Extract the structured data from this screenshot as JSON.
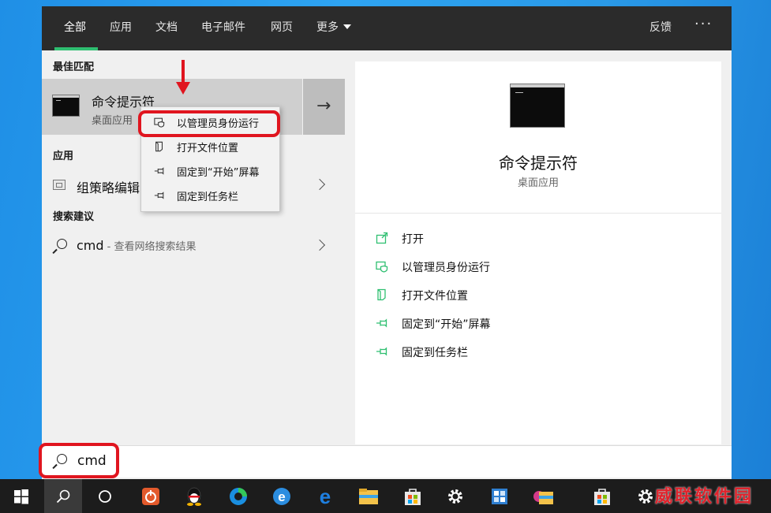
{
  "tabs": [
    {
      "label": "全部",
      "active": true
    },
    {
      "label": "应用"
    },
    {
      "label": "文档"
    },
    {
      "label": "电子邮件"
    },
    {
      "label": "网页"
    },
    {
      "label": "更多"
    }
  ],
  "header": {
    "feedback": "反馈",
    "more_options": "···"
  },
  "left": {
    "best_match_label": "最佳匹配",
    "best_match": {
      "title": "命令提示符",
      "subtitle": "桌面应用",
      "open_arrow": "→"
    },
    "apps_label": "应用",
    "app_item": "组策略编辑",
    "suggestions_label": "搜索建议",
    "web_query": "cmd",
    "web_hint": " - 查看网络搜索结果"
  },
  "context_menu": [
    {
      "label": "以管理员身份运行",
      "icon": "shield-icon"
    },
    {
      "label": "打开文件位置",
      "icon": "folder-icon"
    },
    {
      "label": "固定到“开始”屏幕",
      "icon": "pin-icon"
    },
    {
      "label": "固定到任务栏",
      "icon": "pin-icon"
    }
  ],
  "detail": {
    "title": "命令提示符",
    "subtitle": "桌面应用",
    "actions": [
      {
        "label": "打开",
        "icon": "open-icon"
      },
      {
        "label": "以管理员身份运行",
        "icon": "shield-icon"
      },
      {
        "label": "打开文件位置",
        "icon": "folder-icon"
      },
      {
        "label": "固定到“开始”屏幕",
        "icon": "pin-icon"
      },
      {
        "label": "固定到任务栏",
        "icon": "pin-icon"
      }
    ]
  },
  "search": {
    "value": "cmd"
  },
  "watermark": "威联软件园",
  "colors": {
    "accent": "#2fbf71",
    "annotation": "#e0151f",
    "tabbar": "#2b2b2b"
  }
}
